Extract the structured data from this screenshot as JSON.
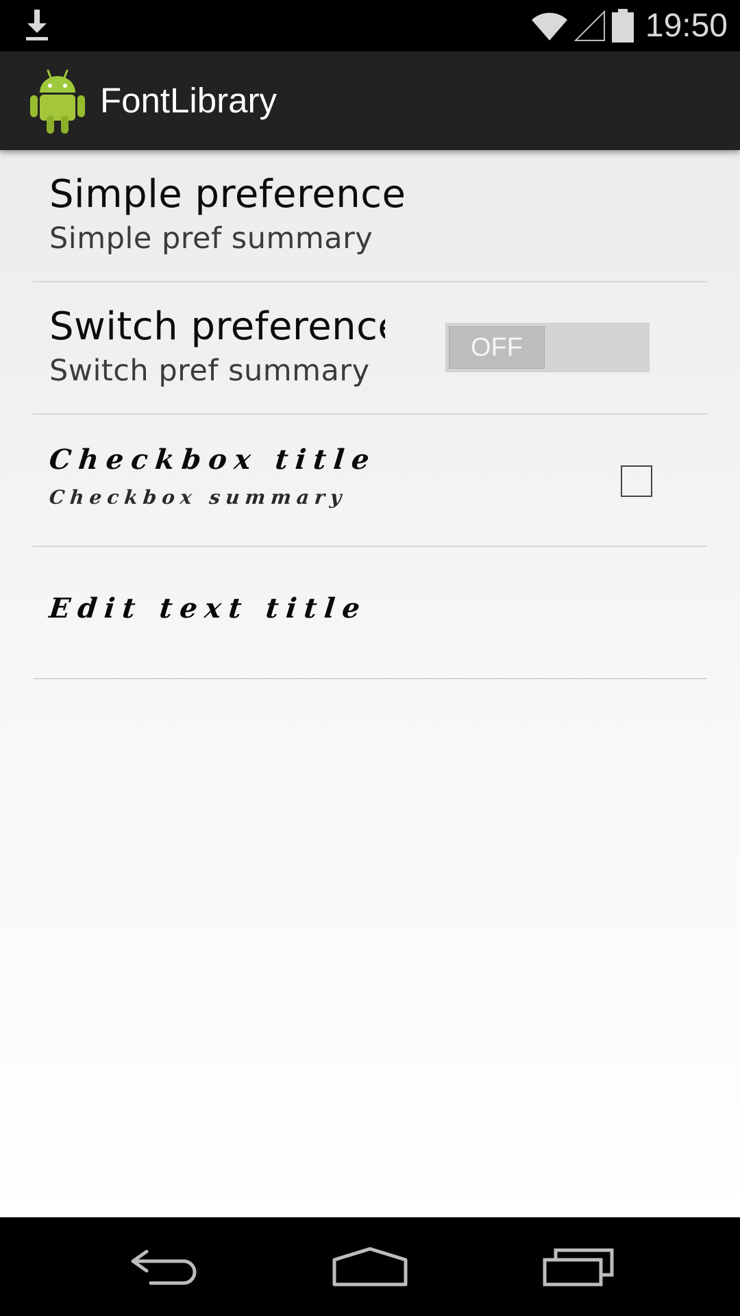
{
  "status_bar": {
    "time": "19:50",
    "icons": [
      "download-icon",
      "wifi-icon",
      "signal-icon",
      "battery-icon"
    ]
  },
  "action_bar": {
    "title": "FontLibrary",
    "icon": "android-robot-icon"
  },
  "preferences": {
    "simple": {
      "title": "Simple preference",
      "summary": "Simple pref summary"
    },
    "switch": {
      "title": "Switch preference",
      "summary": "Switch pref summary",
      "state_label": "OFF",
      "checked": false
    },
    "checkbox": {
      "title": "Checkbox title",
      "summary": "Checkbox summary",
      "checked": false
    },
    "edit_text": {
      "title": "Edit text title"
    }
  },
  "navigation": {
    "back": "back-icon",
    "home": "home-icon",
    "recents": "recent-apps-icon"
  },
  "colors": {
    "status_bar": "#000000",
    "action_bar": "#222222",
    "divider": "#d6d6d6"
  }
}
